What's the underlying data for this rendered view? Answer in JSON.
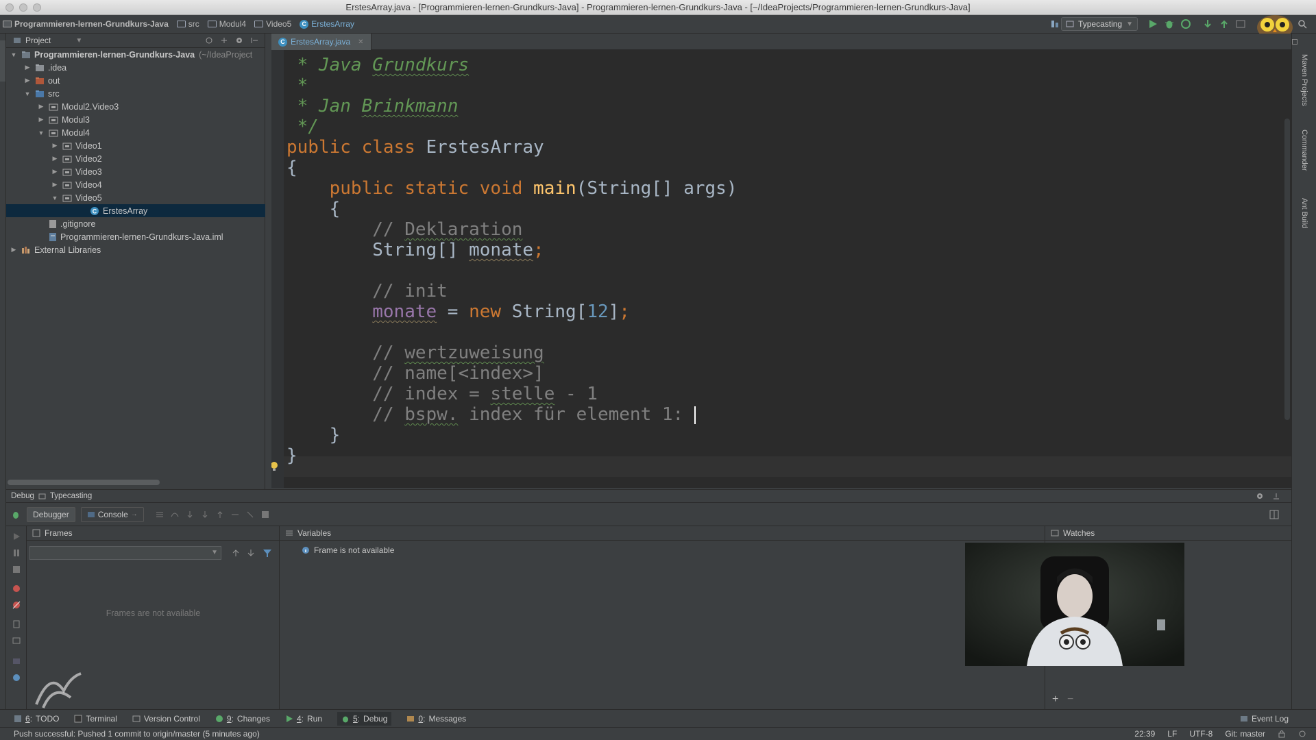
{
  "window": {
    "title": "ErstesArray.java - [Programmieren-lernen-Grundkurs-Java] - Programmieren-lernen-Grundkurs-Java - [~/IdeaProjects/Programmieren-lernen-Grundkurs-Java]"
  },
  "breadcrumbs": [
    "Programmieren-lernen-Grundkurs-Java",
    "src",
    "Modul4",
    "Video5",
    "ErstesArray"
  ],
  "run_config": "Typecasting",
  "project_panel": {
    "title": "Project",
    "tree": [
      {
        "label": "Programmieren-lernen-Grundkurs-Java",
        "hint": "(~/IdeaProject",
        "depth": 0,
        "arrow": "open",
        "icon": "module-folder-icon"
      },
      {
        "label": ".idea",
        "depth": 1,
        "arrow": "closed",
        "icon": "folder-icon"
      },
      {
        "label": "out",
        "depth": 1,
        "arrow": "closed",
        "icon": "excluded-folder-icon"
      },
      {
        "label": "src",
        "depth": 1,
        "arrow": "open",
        "icon": "source-folder-icon"
      },
      {
        "label": "Modul2.Video3",
        "depth": 2,
        "arrow": "closed",
        "icon": "package-icon"
      },
      {
        "label": "Modul3",
        "depth": 2,
        "arrow": "closed",
        "icon": "package-icon"
      },
      {
        "label": "Modul4",
        "depth": 2,
        "arrow": "open",
        "icon": "package-icon"
      },
      {
        "label": "Video1",
        "depth": 3,
        "arrow": "closed",
        "icon": "package-icon"
      },
      {
        "label": "Video2",
        "depth": 3,
        "arrow": "closed",
        "icon": "package-icon"
      },
      {
        "label": "Video3",
        "depth": 3,
        "arrow": "closed",
        "icon": "package-icon"
      },
      {
        "label": "Video4",
        "depth": 3,
        "arrow": "closed",
        "icon": "package-icon"
      },
      {
        "label": "Video5",
        "depth": 3,
        "arrow": "open",
        "icon": "package-icon"
      },
      {
        "label": "ErstesArray",
        "depth": 5,
        "arrow": "none",
        "icon": "java-class-icon",
        "selected": true
      },
      {
        "label": ".gitignore",
        "depth": 2,
        "arrow": "none",
        "icon": "text-file-icon"
      },
      {
        "label": "Programmieren-lernen-Grundkurs-Java.iml",
        "depth": 2,
        "arrow": "none",
        "icon": "iml-file-icon"
      },
      {
        "label": "External Libraries",
        "depth": 0,
        "arrow": "closed",
        "icon": "library-icon"
      }
    ]
  },
  "editor": {
    "tab_label": "ErstesArray.java",
    "lines": [
      [
        {
          "t": " * ",
          "c": "jd"
        },
        {
          "t": "Java",
          "c": "jd"
        },
        {
          "t": " ",
          "c": "jd"
        },
        {
          "t": "Grundkurs",
          "c": "jd wavy"
        }
      ],
      [
        {
          "t": " *",
          "c": "jd"
        }
      ],
      [
        {
          "t": " * ",
          "c": "jd"
        },
        {
          "t": "Jan",
          "c": "jd"
        },
        {
          "t": " ",
          "c": "jd"
        },
        {
          "t": "Brinkmann",
          "c": "jd wavy"
        }
      ],
      [
        {
          "t": " */",
          "c": "jd"
        }
      ],
      [
        {
          "t": "public class ",
          "c": "kw"
        },
        {
          "t": "ErstesArray",
          "c": ""
        }
      ],
      [
        {
          "t": "{",
          "c": ""
        }
      ],
      [
        {
          "t": "    ",
          "c": ""
        },
        {
          "t": "public static void ",
          "c": "kw"
        },
        {
          "t": "main",
          "c": "fn"
        },
        {
          "t": "(String[] args)",
          "c": ""
        }
      ],
      [
        {
          "t": "    {",
          "c": ""
        }
      ],
      [
        {
          "t": "        // ",
          "c": "cm"
        },
        {
          "t": "Deklaration",
          "c": "cm wavy"
        }
      ],
      [
        {
          "t": "        String[] ",
          "c": ""
        },
        {
          "t": "monate",
          "c": "wavy-o"
        },
        {
          "t": ";",
          "c": "kw"
        }
      ],
      [
        {
          "t": "",
          "c": ""
        }
      ],
      [
        {
          "t": "        // init",
          "c": "cm"
        }
      ],
      [
        {
          "t": "        ",
          "c": ""
        },
        {
          "t": "monate",
          "c": "fld wavy-o"
        },
        {
          "t": " = ",
          "c": ""
        },
        {
          "t": "new ",
          "c": "kw"
        },
        {
          "t": "String[",
          "c": ""
        },
        {
          "t": "12",
          "c": "num"
        },
        {
          "t": "]",
          "c": ""
        },
        {
          "t": ";",
          "c": "kw"
        }
      ],
      [
        {
          "t": "",
          "c": ""
        }
      ],
      [
        {
          "t": "        // ",
          "c": "cm"
        },
        {
          "t": "wertzuweisung",
          "c": "cm wavy"
        }
      ],
      [
        {
          "t": "        // name[<index>]",
          "c": "cm"
        }
      ],
      [
        {
          "t": "        // index = ",
          "c": "cm"
        },
        {
          "t": "stelle",
          "c": "cm wavy"
        },
        {
          "t": " - 1",
          "c": "cm"
        }
      ],
      [
        {
          "t": "        // ",
          "c": "cm"
        },
        {
          "t": "bspw.",
          "c": "cm wavy"
        },
        {
          "t": " index für element 1: ",
          "c": "cm"
        },
        {
          "t": "|CURSOR|",
          "c": "cursor"
        }
      ],
      [
        {
          "t": "    }",
          "c": ""
        }
      ],
      [
        {
          "t": "}",
          "c": ""
        }
      ]
    ]
  },
  "right_strip": [
    "Maven Projects",
    "Commander",
    "Ant Build"
  ],
  "debug": {
    "header_label": "Debug",
    "config_label": "Typecasting",
    "tab_debugger": "Debugger",
    "tab_console": "Console",
    "frames_title": "Frames",
    "frames_empty": "Frames are not available",
    "variables_title": "Variables",
    "variables_message": "Frame is not available",
    "watches_title": "Watches"
  },
  "tool_windows": [
    {
      "num": "6",
      "label": "TODO",
      "icon": "todo-icon"
    },
    {
      "num": "",
      "label": "Terminal",
      "icon": "terminal-icon"
    },
    {
      "num": "",
      "label": "Version Control",
      "icon": "version-control-icon"
    },
    {
      "num": "9",
      "label": "Changes",
      "icon": "changes-icon"
    },
    {
      "num": "4",
      "label": "Run",
      "icon": "run-icon"
    },
    {
      "num": "5",
      "label": "Debug",
      "icon": "debug-icon",
      "active": true
    },
    {
      "num": "0",
      "label": "Messages",
      "icon": "messages-icon"
    }
  ],
  "event_log": "Event Log",
  "status": {
    "message": "Push successful: Pushed 1 commit to origin/master (5 minutes ago)",
    "time": "22:39",
    "line_sep": "LF",
    "encoding": "UTF-8",
    "git": "Git: master"
  },
  "colors": {
    "editor_bg": "#2b2b2b",
    "panel_bg": "#3c3f41",
    "selection": "#0d293e",
    "keyword": "#cc7832",
    "comment": "#808080",
    "doc_comment": "#629755",
    "function": "#ffc66d",
    "number": "#6897bb"
  }
}
